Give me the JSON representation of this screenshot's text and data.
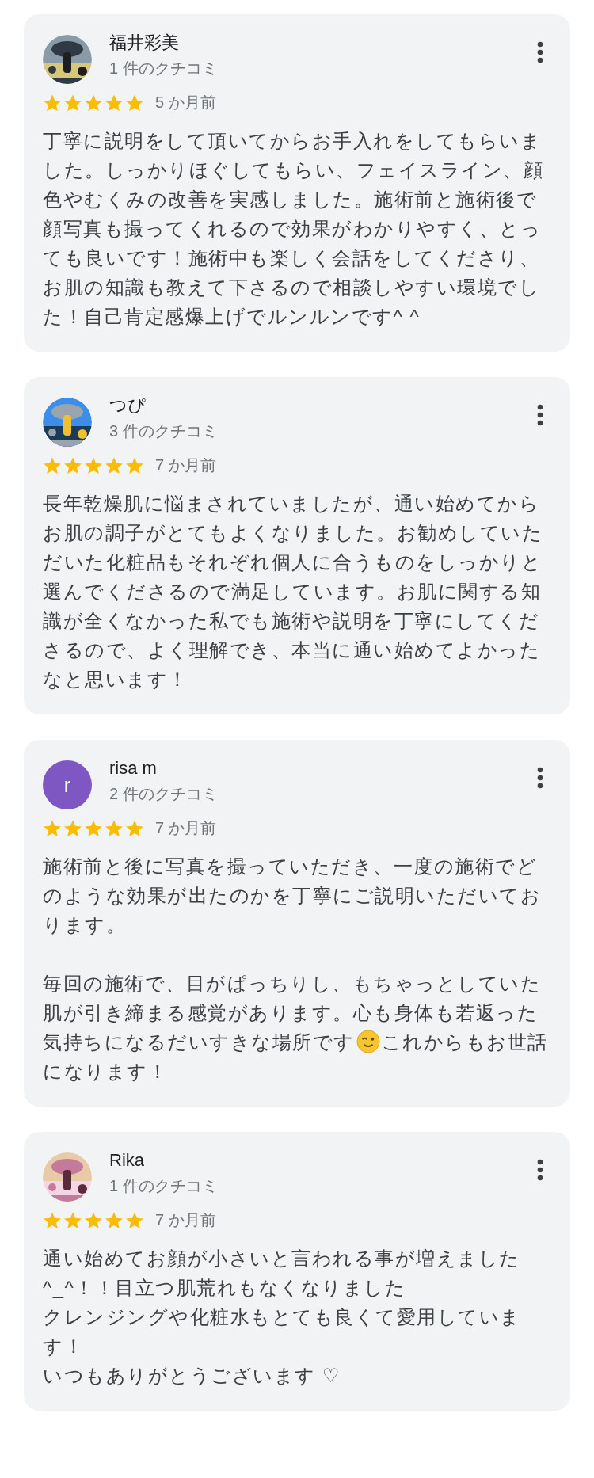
{
  "reviews": [
    {
      "name": "福井彩美",
      "avatar": {
        "kind": "picture"
      },
      "review_count": "1 件のクチコミ",
      "stars": 5,
      "time": "5 か月前",
      "body": [
        {
          "kind": "paragraph",
          "segments": [
            {
              "kind": "text",
              "text": "丁寧に説明をして頂いてからお手入れをしてもらいました。しっかりほぐしてもらい、フェイスライン、顔色やむくみの改善を実感しました。施術前と施術後で顔写真も撮ってくれるので効果がわかりやすく、とっても良いです！施術中も楽しく会話をしてくださり、お肌の知識も教えて下さるので相談しやすい環境でした！自己肯定感爆上げでルンルンです^ ^"
            }
          ]
        }
      ]
    },
    {
      "name": "つぴ",
      "avatar": {
        "kind": "picture"
      },
      "review_count": "3 件のクチコミ",
      "stars": 5,
      "time": "7 か月前",
      "body": [
        {
          "kind": "paragraph",
          "segments": [
            {
              "kind": "text",
              "text": "長年乾燥肌に悩まされていましたが、通い始めてからお肌の調子がとてもよくなりました。お勧めしていただいた化粧品もそれぞれ個人に合うものをしっかりと選んでくださるので満足しています。お肌に関する知識が全くなかった私でも施術や説明を丁寧にしてくださるので、よく理解でき、本当に通い始めてよかったなと思います！"
            }
          ]
        }
      ]
    },
    {
      "name": "risa m",
      "avatar": {
        "kind": "initial",
        "letter": "r",
        "color": "#7e57c2"
      },
      "review_count": "2 件のクチコミ",
      "stars": 5,
      "time": "7 か月前",
      "body": [
        {
          "kind": "paragraph",
          "segments": [
            {
              "kind": "text",
              "text": "施術前と後に写真を撮っていただき、一度の施術でどのような効果が出たのかを丁寧にご説明いただいております。"
            }
          ]
        },
        {
          "kind": "blank"
        },
        {
          "kind": "paragraph",
          "segments": [
            {
              "kind": "text",
              "text": "毎回の施術で、目がぱっちりし、もちゃっとしていた肌が引き締まる感覚があります。心も身体も若返った気持ちになるだいすきな場所です"
            },
            {
              "kind": "emoji"
            },
            {
              "kind": "text",
              "text": "これからもお世話になります！"
            }
          ]
        }
      ]
    },
    {
      "name": "Rika",
      "avatar": {
        "kind": "picture"
      },
      "review_count": "1 件のクチコミ",
      "stars": 5,
      "time": "7 か月前",
      "body": [
        {
          "kind": "paragraph",
          "segments": [
            {
              "kind": "text",
              "text": "通い始めてお顔が小さいと言われる事が増えました^_^！！目立つ肌荒れもなくなりました"
            }
          ]
        },
        {
          "kind": "paragraph",
          "segments": [
            {
              "kind": "text",
              "text": "クレンジングや化粧水もとても良くて愛用しています！"
            }
          ]
        },
        {
          "kind": "paragraph",
          "segments": [
            {
              "kind": "text",
              "text": "いつもありがとうございます ♡"
            }
          ]
        }
      ]
    }
  ]
}
